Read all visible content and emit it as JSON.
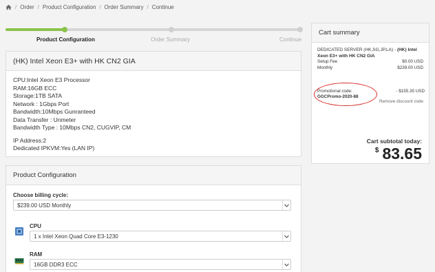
{
  "breadcrumb": {
    "items": [
      "Order",
      "Product Configuration",
      "Order Summary",
      "Continue"
    ]
  },
  "steps": {
    "items": [
      {
        "label": "Product Configuration",
        "state": "active"
      },
      {
        "label": "Order Summary",
        "state": "inactive"
      },
      {
        "label": "Continue",
        "state": "inactive"
      }
    ],
    "progress": 0.2
  },
  "product": {
    "title": "(HK) Intel Xeon E3+ with HK CN2 GIA",
    "specs": [
      "CPU:Intel Xeon E3 Processor",
      "RAM:16GB ECC",
      "Storage:1TB SATA",
      "Network : 1Gbps Port",
      "Bandwidth:10Mbps Gunranteed",
      "Data Transfer : Unmeter",
      "Bandwidth Type : 10Mbps CN2, CUGVIP, CM"
    ],
    "extra": [
      "IP Address:2",
      "Dedicated IPKVM:Yes (LAN IP)"
    ]
  },
  "config": {
    "title": "Product Configuration",
    "billing_label": "Choose billing cycle:",
    "billing_value": "$239.00 USD Monthly",
    "cpu_label": "CPU",
    "cpu_value": "1 x Intel Xeon Quad Core E3-1230",
    "ram_label": "RAM",
    "ram_value": "16GB DDR3 ECC"
  },
  "cart": {
    "title": "Cart summary",
    "group": "DEDICATED SERVER (HK,SG,JP,LA) - ",
    "product": "(HK) Intel Xeon E3+ with HK CN2 GIA",
    "setup_label": "Setup Fee",
    "setup_value": "$0.00 USD",
    "monthly_label": "Monthly",
    "monthly_value": "$239.00 USD",
    "promo_label": "Promotional code: ",
    "promo_code": "GGCPromo-2020-88",
    "promo_value": "- $155.35 USD",
    "remove_label": "Remove discount code",
    "subtotal_label": "Cart subtotal today:",
    "currency": "$",
    "subtotal_value": "83.65"
  },
  "colors": {
    "accent": "#8bc34a",
    "annotation": "#d9302c"
  },
  "icons": {
    "home": "home-icon",
    "caret": "chevron-down-icon",
    "cpu": "cpu-icon",
    "ram": "ram-icon"
  }
}
